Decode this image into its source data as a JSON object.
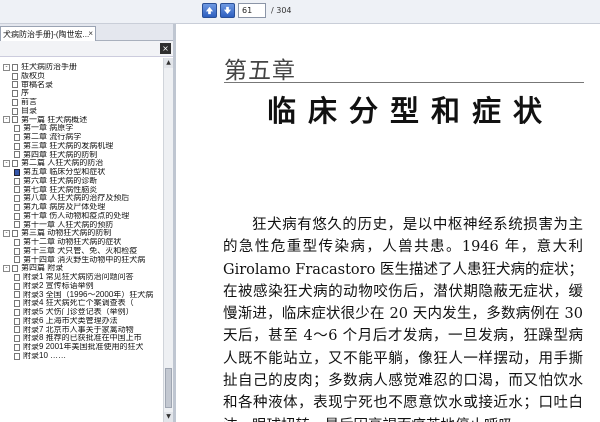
{
  "toolbar": {
    "current_page": "61",
    "total_pages": "/ 304"
  },
  "left_panel": {
    "tab_label": "犬病防治手册]-(陶世宏...",
    "tab_close": "×",
    "pane_close": "×",
    "tree": [
      {
        "level": 0,
        "label": "狂犬病防治手册",
        "expander": "-"
      },
      {
        "level": 1,
        "label": "版权页"
      },
      {
        "level": 1,
        "label": "审稿名录"
      },
      {
        "level": 1,
        "label": "序"
      },
      {
        "level": 1,
        "label": "前言"
      },
      {
        "level": 1,
        "label": "目录"
      },
      {
        "level": 1,
        "label": "第一篇    狂犬病概述",
        "expander": "-"
      },
      {
        "level": 2,
        "label": "第一章    病原学"
      },
      {
        "level": 2,
        "label": "第二章    流行病学"
      },
      {
        "level": 2,
        "label": "第三章    狂犬病的发病机理"
      },
      {
        "level": 2,
        "label": "第四章    狂犬病的防制"
      },
      {
        "level": 1,
        "label": "第二篇    人狂犬病的防治",
        "expander": "-"
      },
      {
        "level": 2,
        "label": "第五章    临床分型和症状",
        "selected": true
      },
      {
        "level": 2,
        "label": "第六章    狂犬病的诊断"
      },
      {
        "level": 2,
        "label": "第七章    狂犬病性脑炎"
      },
      {
        "level": 2,
        "label": "第八章    人狂犬病的治疗及预后"
      },
      {
        "level": 2,
        "label": "第九章    病房及尸体处理"
      },
      {
        "level": 2,
        "label": "第十章    伤人动物和疫点的处理"
      },
      {
        "level": 2,
        "label": "第十一章    人狂犬病的预防"
      },
      {
        "level": 1,
        "label": "第三篇    动物狂犬病的防制",
        "expander": "-"
      },
      {
        "level": 2,
        "label": "第十二章    动物狂犬病的症状"
      },
      {
        "level": 2,
        "label": "第十三章    犬只管、免、灭和检疫"
      },
      {
        "level": 2,
        "label": "第十四章    消灭野生动物中的狂犬病"
      },
      {
        "level": 1,
        "label": "第四篇    附录",
        "expander": "-"
      },
      {
        "level": 2,
        "label": "附录1    常见狂犬病防治问题问答"
      },
      {
        "level": 2,
        "label": "附录2    宣传标语举例"
      },
      {
        "level": 2,
        "label": "附录3    全国（1996～2000年）狂犬病"
      },
      {
        "level": 2,
        "label": "附录4    狂犬病死亡个案调查表（"
      },
      {
        "level": 2,
        "label": "附录5    犬伤门诊登记表（举例）"
      },
      {
        "level": 2,
        "label": "附录6    上海市犬类管理办法"
      },
      {
        "level": 2,
        "label": "附录7    北京市人事关于家禽动物"
      },
      {
        "level": 2,
        "label": "附录8    推荐的已获批准在中国上市"
      },
      {
        "level": 2,
        "label": "附录9    2001年美国批准使用的狂犬"
      },
      {
        "level": 2,
        "label": "附录10    ……"
      }
    ]
  },
  "document": {
    "chapter": "第五章",
    "title": "临床分型和症状",
    "paragraph": "狂犬病有悠久的历史，是以中枢神经系统损害为主的急性危重型传染病，人兽共患。1946 年，意大利 Girolamo Fracastoro 医生描述了人患狂犬病的症状；在被感染狂犬病的动物咬伤后，潜伏期隐蔽无症状，缓慢渐进，临床症状很少在 20 天内发生，多数病例在 30 天后，甚至 4～6 个月后才发病，一旦发病，狂躁型病人既不能站立，又不能平躺，像狂人一样摆动，用手撕扯自己的皮肉；多数病人感觉难忍的口渴，而又怕饮水和各种液体，表现宁死也不愿意饮水或接近水；口吐白沫，眼球扭转，最后因衰竭而痛苦地停止呼吸。"
  }
}
